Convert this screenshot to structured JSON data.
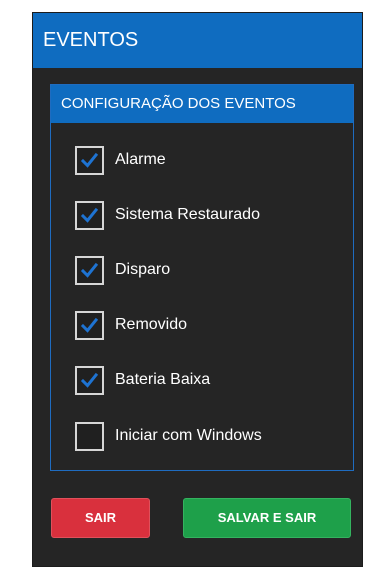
{
  "window": {
    "title": "EVENTOS"
  },
  "group": {
    "title": "CONFIGURAÇÃO DOS EVENTOS"
  },
  "options": [
    {
      "label": "Alarme",
      "checked": true
    },
    {
      "label": "Sistema Restaurado",
      "checked": true
    },
    {
      "label": "Disparo",
      "checked": true
    },
    {
      "label": "Removido",
      "checked": true
    },
    {
      "label": "Bateria Baixa",
      "checked": true
    },
    {
      "label": "Iniciar com Windows",
      "checked": false
    }
  ],
  "buttons": {
    "exit_label": "SAIR",
    "save_label": "SALVAR E SAIR"
  },
  "colors": {
    "accent": "#0f6cc0",
    "background": "#252525",
    "check_blue": "#1e73d2",
    "exit_red": "#d9303d",
    "save_green": "#1ea04a"
  }
}
